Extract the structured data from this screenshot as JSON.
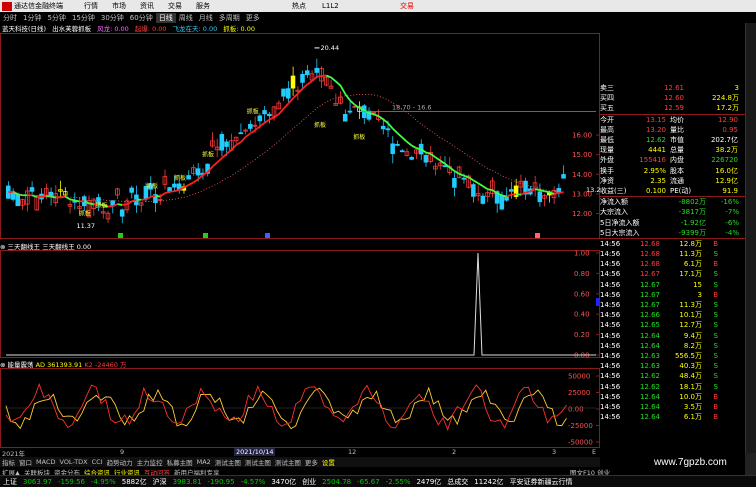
{
  "menu": {
    "app": "通达信金融终端",
    "items": [
      "行情",
      "市场",
      "资讯",
      "交易",
      "服务"
    ],
    "right": [
      "热点",
      "L1L2",
      "交易"
    ]
  },
  "periods": [
    "分时",
    "1分钟",
    "5分钟",
    "15分钟",
    "30分钟",
    "60分钟",
    "日线",
    "周线",
    "月线",
    "多周期",
    "更多"
  ],
  "indicator_bar": {
    "name": "蓝天科技(日线)",
    "formula": "出水芙蓉抓板",
    "a": "风龙: 0.00",
    "b": "起爆: 0.00",
    "c": "飞龙在天: 0.00",
    "d": "抓板: 0.00"
  },
  "main_chart": {
    "high_label": "20.44",
    "low_label": "11.37",
    "line_label": "18.70 - 16.6",
    "last_label": "13.2",
    "yaxis": [
      "16.00",
      "15.00",
      "14.00",
      "13.00",
      "12.00"
    ],
    "markers": [
      "抓板",
      "抓板",
      "抓板",
      "抓板",
      "抓板",
      "抓板",
      "抓板",
      "抓板"
    ],
    "colors": {
      "up": "#ff3b3b",
      "down": "#22ccff",
      "ma_up": "#ff2020",
      "ma_down": "#40ff40",
      "dot": "#ff6060"
    }
  },
  "sub1": {
    "label": "三天翻线王",
    "label2": "三天翻线王",
    "val": "0.00",
    "yaxis": [
      "1.00",
      "0.80",
      "0.60",
      "0.40",
      "0.20",
      "0.00"
    ],
    "badge": "0.48"
  },
  "sub2": {
    "label": "能量震荡",
    "ad": "AD",
    "adv": "361393.91",
    "x": "K2",
    "xv": "-24460",
    "z": "万",
    "yaxis": [
      "50000",
      "25000",
      "0.00",
      "-25000",
      "-50000"
    ]
  },
  "xaxis": {
    "left": "2021年",
    "mid": "2021/10/14",
    "marks": [
      "9",
      "12",
      "2",
      "3"
    ],
    "right": "E"
  },
  "tabs": [
    "扩展▲",
    "关联板块",
    "资金分布",
    "综合资讯",
    "行业资讯",
    "互动问答",
    "新用户福利专享"
  ],
  "subtabs": [
    "指标",
    "窗口",
    "MACD",
    "VOL-TDX",
    "CCI",
    "趋势动力",
    "主力监控",
    "私募主图",
    "MA2",
    "测试主图",
    "测试主图",
    "测试主图",
    "更多",
    "设置"
  ],
  "status": {
    "sh_name": "上证",
    "sh_val": "3063.97",
    "sh_chg": "-159.56",
    "sh_pct": "-4.95%",
    "sh_amt": "5882亿",
    "sz_name": "沪深",
    "sz_val": "3983.81",
    "sz_chg": "-190.95",
    "sz_pct": "-4.57%",
    "sz_amt": "3470亿",
    "cy_name": "创业",
    "cy_val": "2504.78",
    "cy_chg": "-65.67",
    "cy_pct": "-2.55%",
    "cy_amt": "2479亿",
    "total": "总成交",
    "total_amt": "11242亿",
    "feed": "平安证券新疆云行情"
  },
  "quote": {
    "book": [
      {
        "k": "卖三",
        "p": "12.61",
        "v": "3"
      },
      {
        "k": "买四",
        "p": "12.60",
        "v": "224.8万"
      },
      {
        "k": "买五",
        "p": "12.59",
        "v": "17.2万"
      }
    ],
    "stats": [
      {
        "k": "今开",
        "v": "13.15",
        "k2": "均价",
        "v2": "12.90"
      },
      {
        "k": "最高",
        "v": "13.20",
        "k2": "量比",
        "v2": "0.95"
      },
      {
        "k": "最低",
        "v": "12.62",
        "k2": "市值",
        "v2": "202.7亿"
      },
      {
        "k": "现量",
        "v": "4441",
        "k2": "总量",
        "v2": "38.2万"
      },
      {
        "k": "外盘",
        "v": "155416",
        "k2": "内盘",
        "v2": "226720"
      },
      {
        "k": "换手",
        "v": "2.95%",
        "k2": "股本",
        "v2": "16.0亿"
      },
      {
        "k": "净资",
        "v": "2.35",
        "k2": "流通",
        "v2": "12.9亿"
      },
      {
        "k": "收益(三)",
        "v": "0.100",
        "k2": "PE(动)",
        "v2": "91.9"
      }
    ],
    "flows": [
      {
        "k": "净流入额",
        "v": "-8802万",
        "p": "-16%"
      },
      {
        "k": "大宗流入",
        "v": "-3817万",
        "p": "-7%"
      },
      {
        "k": "5日净流入额",
        "v": "-1.92亿",
        "p": "-6%"
      },
      {
        "k": "5日大宗流入",
        "v": "-9399万",
        "p": "-4%"
      }
    ],
    "ticks": [
      {
        "t": "14:56",
        "p": "12.68",
        "v": "12.8万",
        "s": "B"
      },
      {
        "t": "14:56",
        "p": "12.68",
        "v": "11.3万",
        "s": "S"
      },
      {
        "t": "14:56",
        "p": "12.68",
        "v": "6.1万",
        "s": "B"
      },
      {
        "t": "14:56",
        "p": "12.67",
        "v": "17.1万",
        "s": "S"
      },
      {
        "t": "14:56",
        "p": "12.67",
        "v": "15",
        "s": "S"
      },
      {
        "t": "14:56",
        "p": "12.67",
        "v": "3",
        "s": "B"
      },
      {
        "t": "14:56",
        "p": "12.67",
        "v": "11.3万",
        "s": "S"
      },
      {
        "t": "14:56",
        "p": "12.66",
        "v": "10.1万",
        "s": "S"
      },
      {
        "t": "14:56",
        "p": "12.65",
        "v": "12.7万",
        "s": "S"
      },
      {
        "t": "14:56",
        "p": "12.64",
        "v": "9.4万",
        "s": "S"
      },
      {
        "t": "14:56",
        "p": "12.64",
        "v": "8.2万",
        "s": "S"
      },
      {
        "t": "14:56",
        "p": "12.63",
        "v": "556.5万",
        "s": "S"
      },
      {
        "t": "14:56",
        "p": "12.63",
        "v": "40.3万",
        "s": "S"
      },
      {
        "t": "14:56",
        "p": "12.62",
        "v": "48.4万",
        "s": "S"
      },
      {
        "t": "14:56",
        "p": "12.62",
        "v": "18.1万",
        "s": "S"
      },
      {
        "t": "14:56",
        "p": "12.64",
        "v": "10.0万",
        "s": "B"
      },
      {
        "t": "14:56",
        "p": "12.64",
        "v": "3.5万",
        "s": "B"
      },
      {
        "t": "14:56",
        "p": "12.64",
        "v": "6.1万",
        "s": "B"
      }
    ]
  },
  "corner": "图文F10 创业",
  "watermark": "www.7gpzb.com"
}
